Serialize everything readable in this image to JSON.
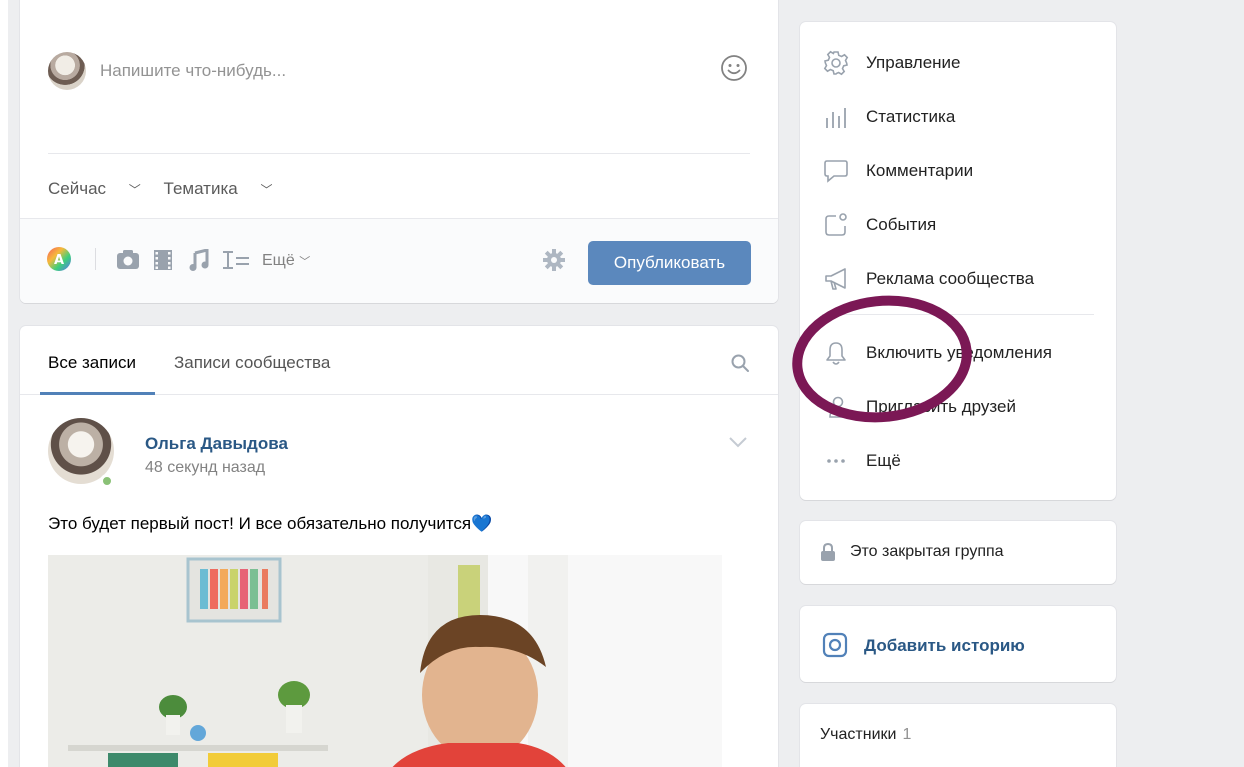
{
  "composer": {
    "placeholder": "Напишите что-нибудь...",
    "time_option": "Сейчас",
    "topic_option": "Тематика",
    "more_label": "Ещё",
    "publish_label": "Опубликовать"
  },
  "feed": {
    "tabs": [
      {
        "label": "Все записи",
        "active": true
      },
      {
        "label": "Записи сообщества",
        "active": false
      }
    ],
    "post": {
      "author": "Ольга Давыдова",
      "time": "48 секунд назад",
      "text": "Это будет первый пост! И все обязательно получится💙"
    }
  },
  "menu": {
    "items": [
      {
        "label": "Управление",
        "icon": "gear-icon"
      },
      {
        "label": "Статистика",
        "icon": "stats-icon"
      },
      {
        "label": "Комментарии",
        "icon": "comment-icon"
      },
      {
        "label": "События",
        "icon": "events-icon"
      },
      {
        "label": "Реклама сообщества",
        "icon": "megaphone-icon"
      },
      {
        "label": "Включить уведомления",
        "icon": "bell-icon"
      },
      {
        "label": "Пригласить друзей",
        "icon": "invite-icon"
      },
      {
        "label": "Ещё",
        "icon": "more-dots-icon"
      }
    ]
  },
  "group": {
    "closed_label": "Это закрытая группа"
  },
  "story": {
    "label": "Добавить историю"
  },
  "members": {
    "label": "Участники",
    "count": "1"
  },
  "colors": {
    "accent": "#5181b8",
    "button": "#5b88bd",
    "link": "#2a5885",
    "annotation": "#7b1855",
    "online": "#8ac176"
  }
}
